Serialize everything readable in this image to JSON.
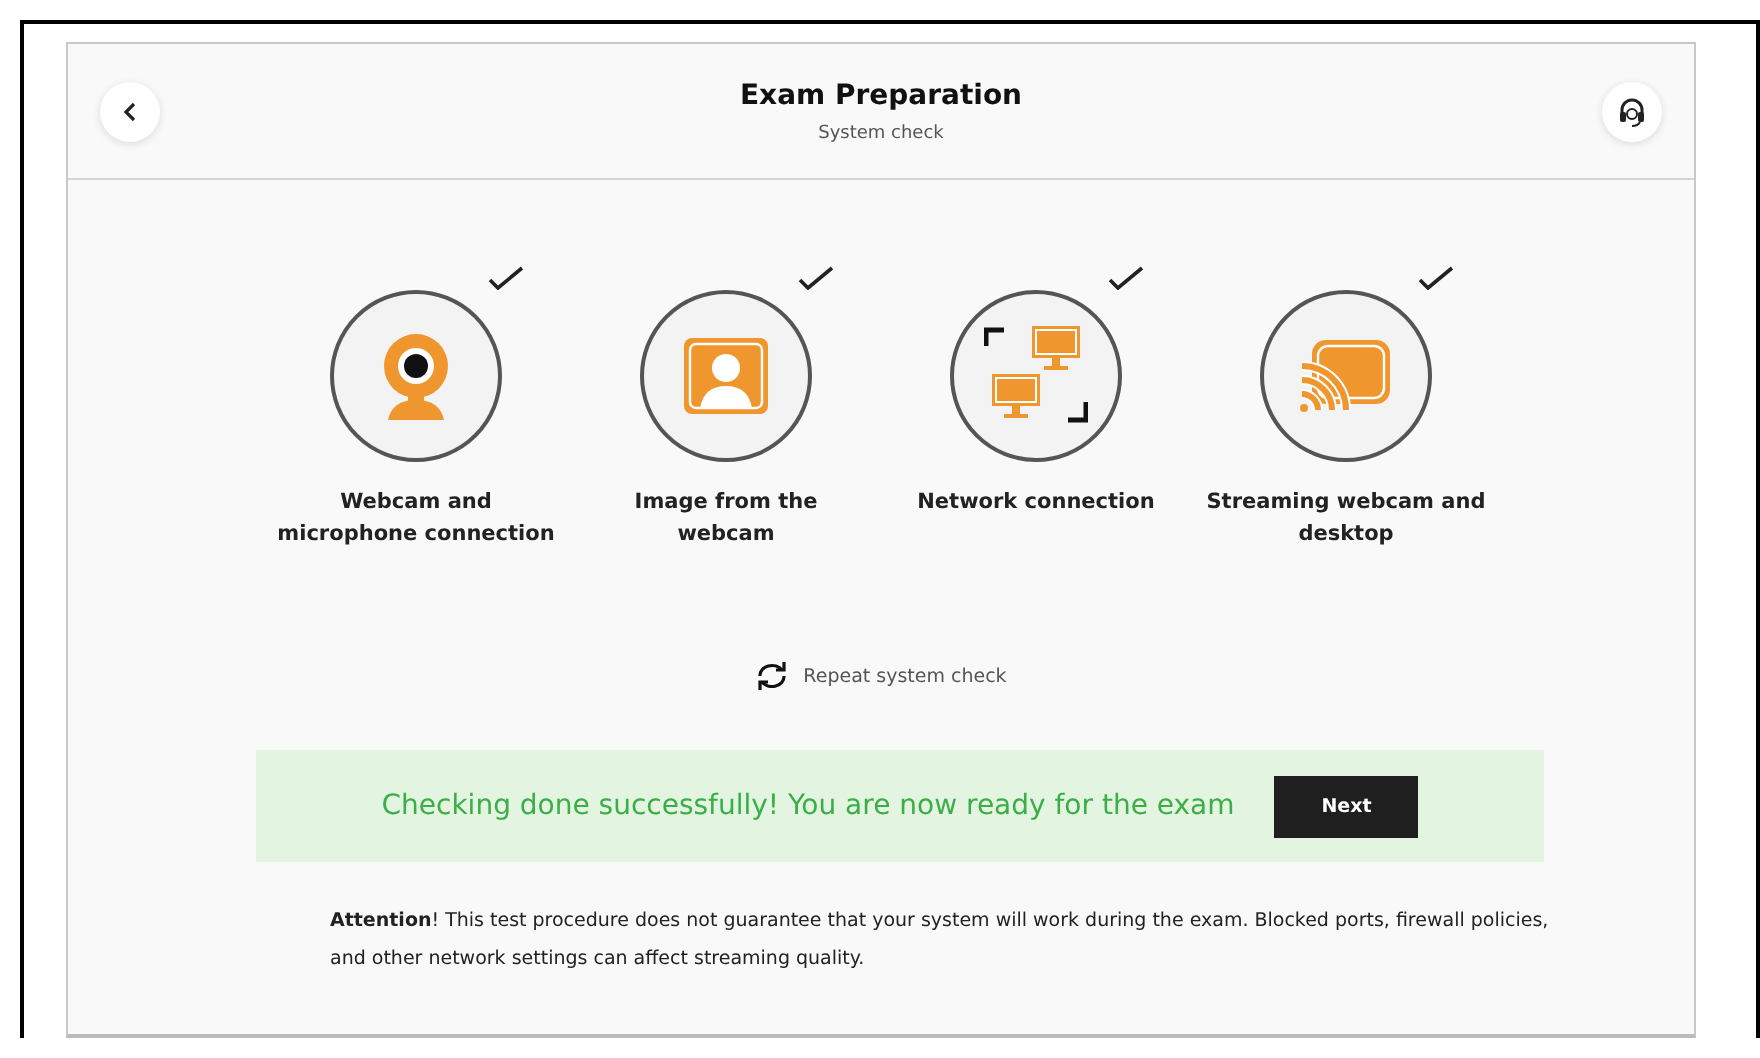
{
  "header": {
    "title": "Exam Preparation",
    "subtitle": "System check"
  },
  "checks": [
    {
      "kind": "webcam",
      "label": "Webcam and microphone connection",
      "checked": true
    },
    {
      "kind": "image",
      "label": "Image from the webcam",
      "checked": true
    },
    {
      "kind": "network",
      "label": "Network connection",
      "checked": true
    },
    {
      "kind": "streaming",
      "label": "Streaming webcam and desktop",
      "checked": true
    }
  ],
  "repeat": "Repeat system check",
  "banner": {
    "message": "Checking done successfully! You are now ready for the exam",
    "button": "Next"
  },
  "notice": "**Attention**! This test procedure does not guarantee that your system will work during the exam. Blocked ports, firewall policies, and other network settings can affect streaming quality."
}
